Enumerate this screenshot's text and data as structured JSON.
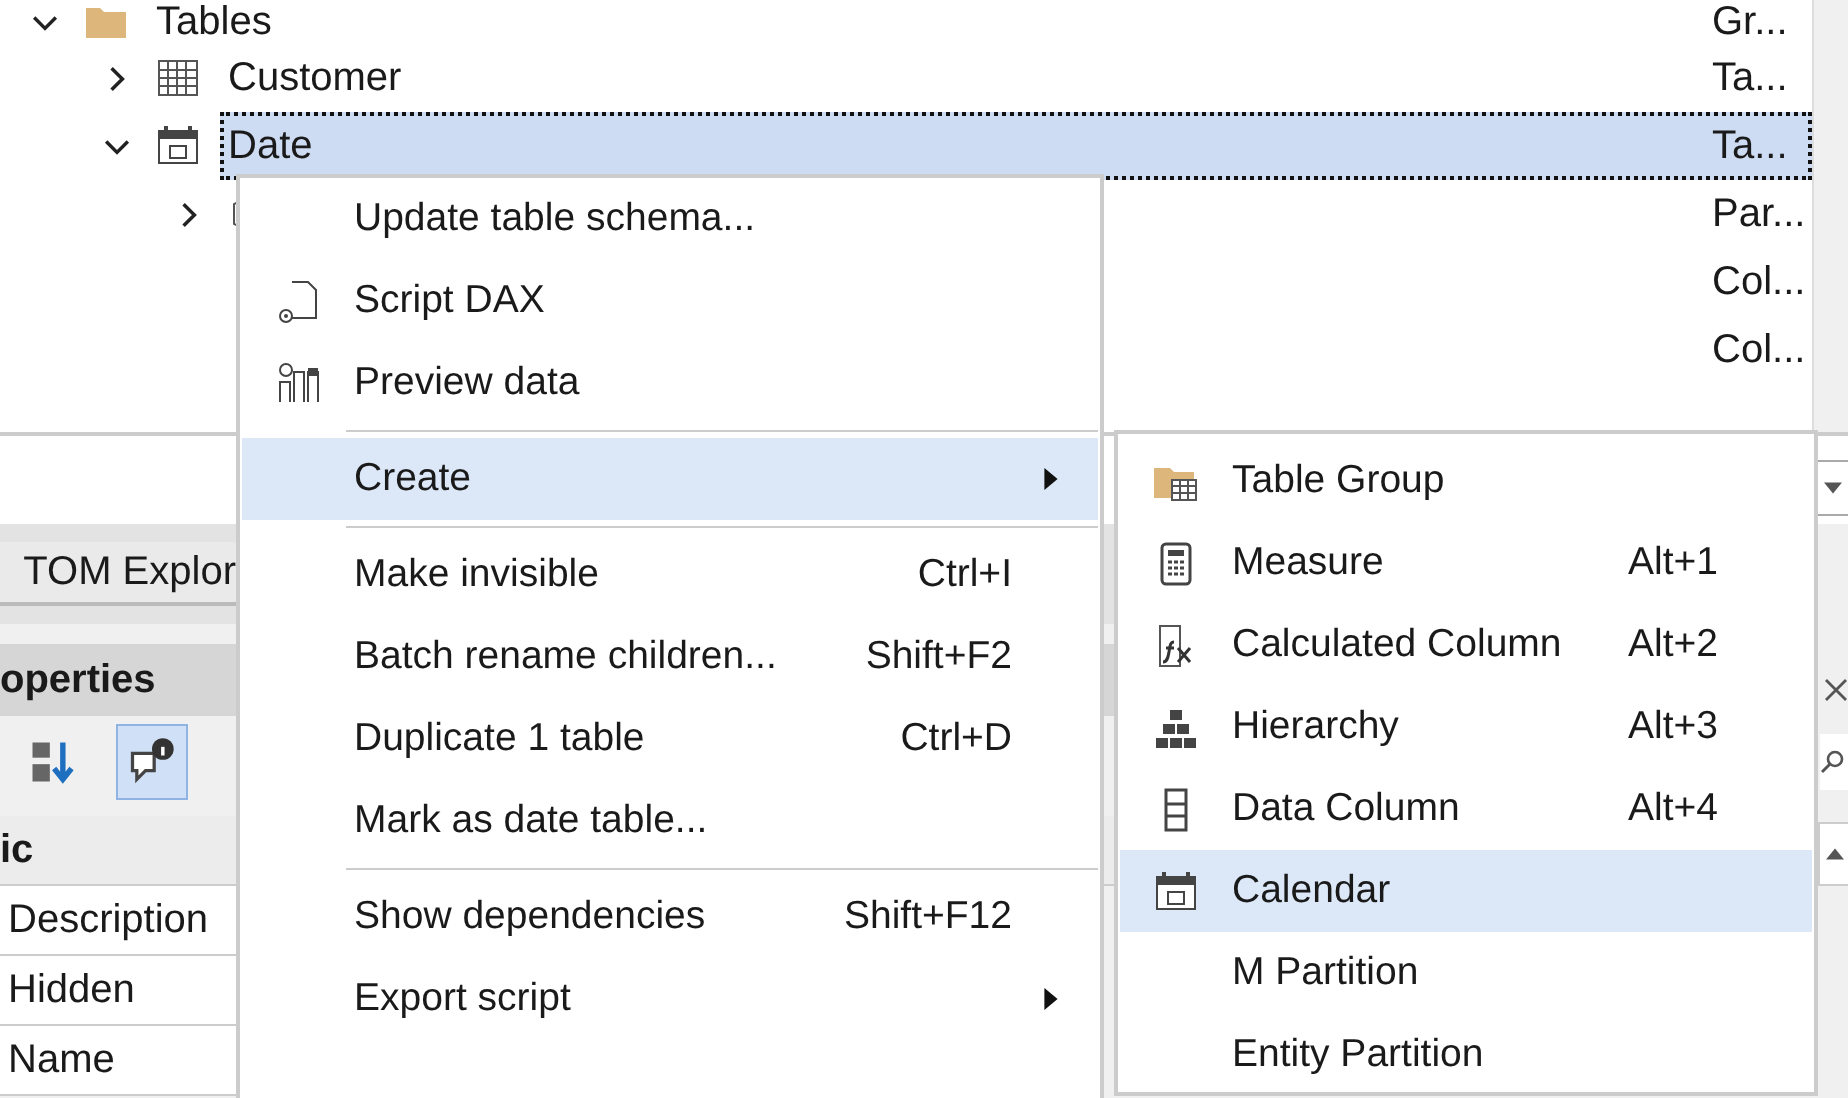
{
  "tree": [
    {
      "name": "Tables",
      "type": "Gr...",
      "kind": "folder",
      "expanded": true,
      "selected": false,
      "children": [
        {
          "name": "Customer",
          "type": "Ta...",
          "kind": "table",
          "expanded": false,
          "selected": false
        },
        {
          "name": "Date",
          "type": "Ta...",
          "kind": "date_table",
          "expanded": true,
          "selected": true,
          "children": [
            {
              "type": "Par...",
              "kind": "partition",
              "expanded": false,
              "selected": false
            },
            {
              "type": "Col...",
              "kind": "column",
              "selected": false
            },
            {
              "type": "Col...",
              "kind": "column",
              "selected": false
            }
          ]
        }
      ]
    }
  ],
  "dock_tab": {
    "label": "TOM Explor"
  },
  "properties": {
    "title": "operties",
    "toolbar": [
      {
        "kind": "sort",
        "selected": false
      },
      {
        "kind": "description",
        "selected": true
      }
    ],
    "category": "ic",
    "rows": [
      "Description",
      "Hidden",
      "Name"
    ]
  },
  "context_menu": {
    "groups": [
      [
        {
          "label": "Update table schema...",
          "selected": false
        },
        {
          "label": "Script DAX",
          "kind": "script",
          "selected": false
        },
        {
          "label": "Preview data",
          "kind": "preview",
          "selected": false
        }
      ],
      [
        {
          "label": "Create",
          "submenu": true,
          "selected": true
        }
      ],
      [
        {
          "label": "Make invisible",
          "shortcut": "Ctrl+I",
          "selected": false
        },
        {
          "label": "Batch rename children...",
          "shortcut": "Shift+F2",
          "selected": false
        },
        {
          "label": "Duplicate 1 table",
          "shortcut": "Ctrl+D",
          "selected": false
        },
        {
          "label": "Mark as date table...",
          "selected": false
        }
      ],
      [
        {
          "label": "Show dependencies",
          "shortcut": "Shift+F12",
          "selected": false
        },
        {
          "label": "Export script",
          "submenu": true,
          "selected": false
        }
      ]
    ]
  },
  "submenu": {
    "items": [
      {
        "label": "Table Group",
        "kind": "table_group",
        "selected": false
      },
      {
        "label": "Measure",
        "kind": "measure",
        "shortcut": "Alt+1",
        "selected": false
      },
      {
        "label": "Calculated Column",
        "kind": "calculated_column",
        "shortcut": "Alt+2",
        "selected": false
      },
      {
        "label": "Hierarchy",
        "kind": "hierarchy",
        "shortcut": "Alt+3",
        "selected": false
      },
      {
        "label": "Data Column",
        "kind": "data_column",
        "shortcut": "Alt+4",
        "selected": false
      },
      {
        "label": "Calendar",
        "kind": "calendar",
        "selected": true
      },
      {
        "label": "M Partition",
        "selected": false
      },
      {
        "label": "Entity Partition",
        "selected": false
      }
    ]
  }
}
